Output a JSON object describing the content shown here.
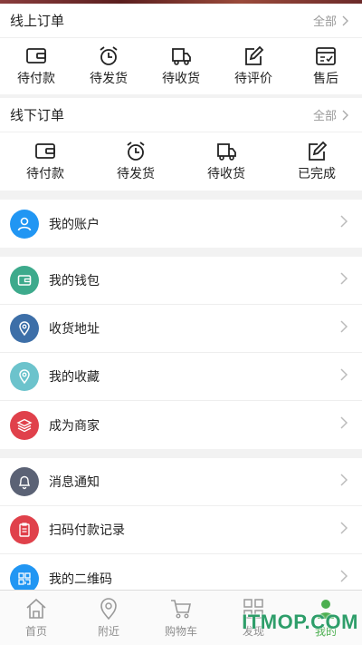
{
  "online_orders": {
    "title": "线上订单",
    "all_label": "全部",
    "items": [
      {
        "label": "待付款",
        "icon": "wallet-icon"
      },
      {
        "label": "待发货",
        "icon": "alarm-clock-icon"
      },
      {
        "label": "待收货",
        "icon": "delivery-truck-icon"
      },
      {
        "label": "待评价",
        "icon": "edit-icon"
      },
      {
        "label": "售后",
        "icon": "after-sale-icon"
      }
    ]
  },
  "offline_orders": {
    "title": "线下订单",
    "all_label": "全部",
    "items": [
      {
        "label": "待付款",
        "icon": "wallet-icon"
      },
      {
        "label": "待发货",
        "icon": "alarm-clock-icon"
      },
      {
        "label": "待收货",
        "icon": "delivery-truck-icon"
      },
      {
        "label": "已完成",
        "icon": "edit-icon"
      }
    ]
  },
  "menu_group1": [
    {
      "label": "我的账户",
      "icon": "user-icon",
      "color": "#2196f3"
    }
  ],
  "menu_group2": [
    {
      "label": "我的钱包",
      "icon": "wallet-icon",
      "color": "#3daa8c"
    },
    {
      "label": "收货地址",
      "icon": "location-pin-icon",
      "color": "#3d6fa8"
    },
    {
      "label": "我的收藏",
      "icon": "location-pin-icon",
      "color": "#6cc3cc"
    },
    {
      "label": "成为商家",
      "icon": "layers-icon",
      "color": "#e0414b"
    }
  ],
  "menu_group3": [
    {
      "label": "消息通知",
      "icon": "bell-icon",
      "color": "#5b6275"
    },
    {
      "label": "扫码付款记录",
      "icon": "clipboard-icon",
      "color": "#e0414b"
    },
    {
      "label": "我的二维码",
      "icon": "qrcode-icon",
      "color": "#2196f3"
    }
  ],
  "tabbar": [
    {
      "label": "首页",
      "icon": "home-icon",
      "active": false
    },
    {
      "label": "附近",
      "icon": "location-pin-icon",
      "active": false
    },
    {
      "label": "购物车",
      "icon": "cart-icon",
      "active": false
    },
    {
      "label": "发现",
      "icon": "grid-icon",
      "active": false
    },
    {
      "label": "我的",
      "icon": "profile-icon",
      "active": true
    }
  ],
  "watermark": "ITMOP.COM",
  "colors": {
    "accent": "#4caf50",
    "text": "#222222",
    "muted": "#999999",
    "background": "#f2f2f2"
  }
}
